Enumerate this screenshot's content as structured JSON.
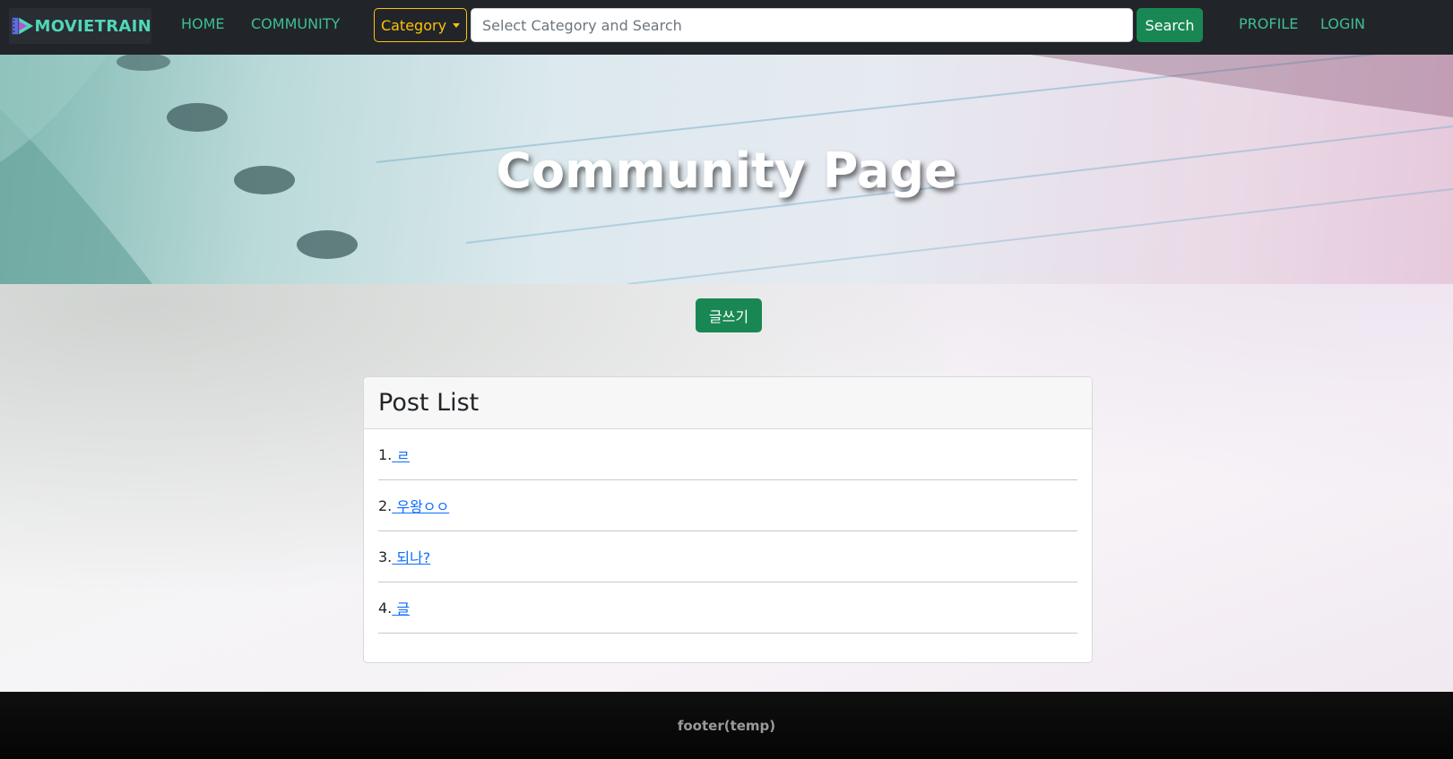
{
  "navbar": {
    "brand": "MOVIETRAIN",
    "links": [
      {
        "label": "HOME"
      },
      {
        "label": "COMMUNITY"
      }
    ],
    "category_label": "Category",
    "search_placeholder": "Select Category and Search",
    "search_button": "Search",
    "right_links": [
      {
        "label": "PROFILE"
      },
      {
        "label": "LOGIN"
      }
    ]
  },
  "hero": {
    "title": "Community Page"
  },
  "main": {
    "write_button": "글쓰기",
    "card_title": "Post List",
    "posts": [
      {
        "num": "1.",
        "title": "ㄹ"
      },
      {
        "num": "2.",
        "title": "우왕ㅇㅇ"
      },
      {
        "num": "3.",
        "title": "되나?"
      },
      {
        "num": "4.",
        "title": "글"
      }
    ]
  },
  "footer": {
    "text": "footer(temp)"
  },
  "colors": {
    "navbar_bg": "#212529",
    "nav_link": "#3fbf92",
    "category_outline": "#ffc107",
    "success": "#198754",
    "link": "#0d6efd"
  }
}
